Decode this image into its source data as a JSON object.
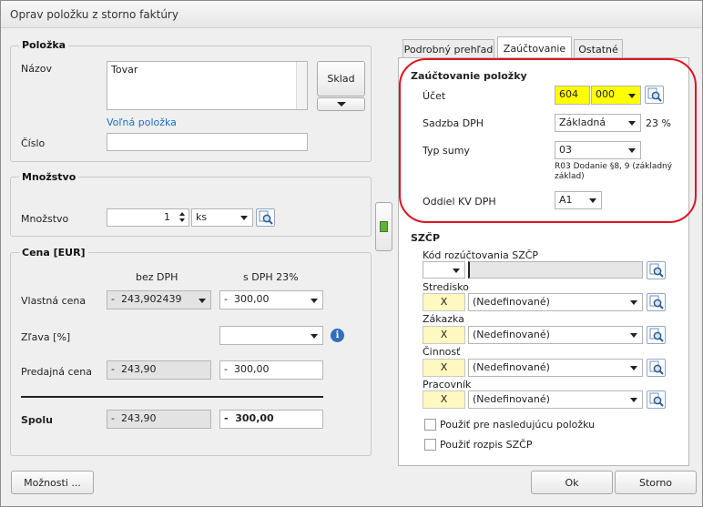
{
  "window": {
    "title": "Oprav položku z storno faktúry"
  },
  "polozka": {
    "title": "Položka",
    "nazov_label": "Názov",
    "nazov_value": "Tovar",
    "sklad_label": "Sklad",
    "volna_label": "Voľná položka",
    "cislo_label": "Číslo",
    "cislo_value": ""
  },
  "mnozstvo": {
    "title": "Množstvo",
    "label": "Množstvo",
    "value": "1",
    "unit": "ks"
  },
  "cena": {
    "title": "Cena [EUR]",
    "col_bez": "bez DPH",
    "col_s": "s DPH 23%",
    "vlastna_label": "Vlastná cena",
    "vlastna_bez_sign": "-",
    "vlastna_bez": "243,902439",
    "vlastna_s_sign": "-",
    "vlastna_s": "300,00",
    "zlava_label": "Zľava [%]",
    "zlava_value": "",
    "predajna_label": "Predajná cena",
    "predajna_bez_sign": "-",
    "predajna_bez": "243,90",
    "predajna_s_sign": "-",
    "predajna_s": "300,00",
    "spolu_label": "Spolu",
    "spolu_bez_sign": "-",
    "spolu_bez": "243,90",
    "spolu_s_sign": "-",
    "spolu_s": "300,00"
  },
  "tabs": [
    {
      "label": "Podrobný prehľad"
    },
    {
      "label": "Zaúčtovanie"
    },
    {
      "label": "Ostatné"
    }
  ],
  "zauctovanie": {
    "title": "Zaúčtovanie položky",
    "ucet_label": "Účet",
    "ucet_1": "604",
    "ucet_2": "000",
    "sadzba_label": "Sadzba DPH",
    "sadzba_value": "Základná",
    "sadzba_pct": "23 %",
    "typ_label": "Typ sumy",
    "typ_value": "03",
    "typ_desc": "R03 Dodanie §8, 9 (základný základ)",
    "oddiel_label": "Oddiel KV DPH",
    "oddiel_value": "A1"
  },
  "szcp": {
    "title": "SZČP",
    "kod_label": "Kód rozúčtovania SZČP",
    "kod_value": "",
    "rows": [
      {
        "label": "Stredisko",
        "x": "X",
        "value": "(Nedefinované)"
      },
      {
        "label": "Zákazka",
        "x": "X",
        "value": "(Nedefinované)"
      },
      {
        "label": "Činnosť",
        "x": "X",
        "value": "(Nedefinované)"
      },
      {
        "label": "Pracovník",
        "x": "X",
        "value": "(Nedefinované)"
      }
    ],
    "chk1": "Použiť pre nasledujúcu položku",
    "chk2": "Použiť rozpis SZČP"
  },
  "footer": {
    "moznosti": "Možnosti ...",
    "ok": "Ok",
    "storno": "Storno"
  },
  "colors": {
    "highlight": "#ffff00",
    "annotation": "#e0141e",
    "link": "#1a6fc9"
  }
}
